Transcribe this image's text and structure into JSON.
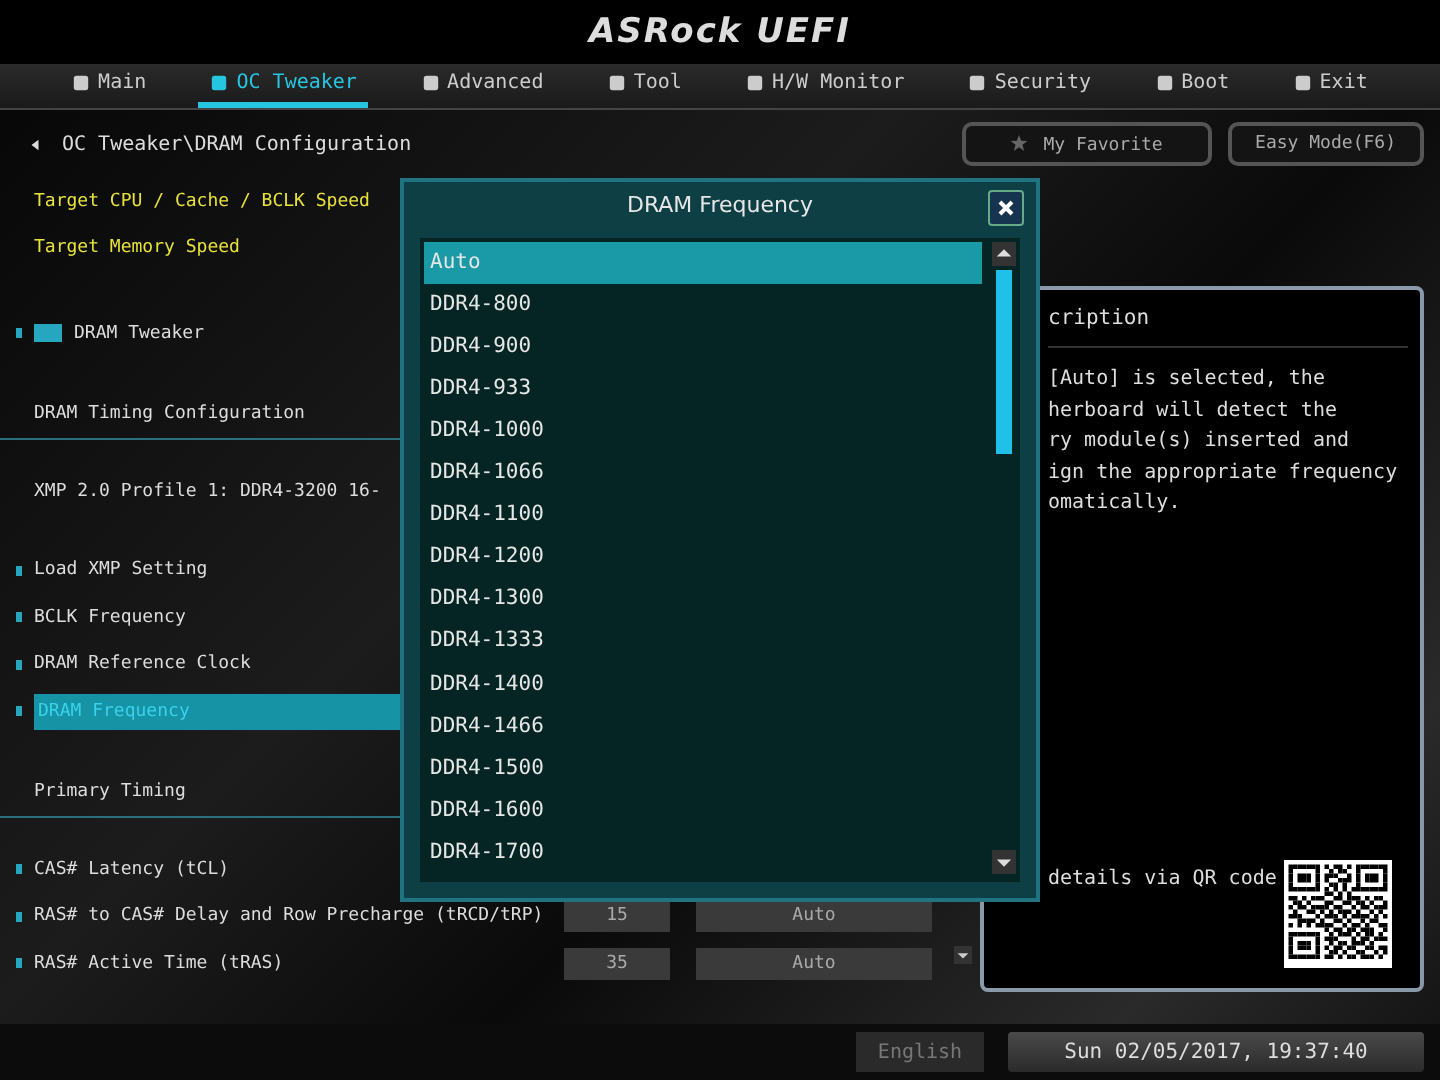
{
  "header": {
    "logo": "ASRock UEFI"
  },
  "tabs": [
    {
      "label": "Main",
      "selected": false
    },
    {
      "label": "OC Tweaker",
      "selected": true
    },
    {
      "label": "Advanced",
      "selected": false
    },
    {
      "label": "Tool",
      "selected": false
    },
    {
      "label": "H/W Monitor",
      "selected": false
    },
    {
      "label": "Security",
      "selected": false
    },
    {
      "label": "Boot",
      "selected": false
    },
    {
      "label": "Exit",
      "selected": false
    }
  ],
  "breadcrumb": "OC Tweaker\\DRAM Configuration",
  "favorite_button": "My Favorite",
  "easy_mode_button": "Easy Mode(F6)",
  "items": [
    {
      "kind": "info",
      "label": "Target CPU / Cache / BCLK Speed"
    },
    {
      "kind": "info",
      "label": "Target Memory Speed"
    },
    {
      "kind": "submenu",
      "label": "DRAM Tweaker"
    },
    {
      "kind": "section",
      "label": "DRAM Timing Configuration"
    },
    {
      "kind": "text",
      "label": "XMP 2.0 Profile 1: DDR4-3200 16-"
    },
    {
      "kind": "setting",
      "label": "Load XMP Setting",
      "selected": false
    },
    {
      "kind": "setting",
      "label": "BCLK Frequency",
      "selected": false
    },
    {
      "kind": "setting",
      "label": "DRAM Reference Clock",
      "selected": false
    },
    {
      "kind": "setting",
      "label": "DRAM Frequency",
      "selected": true
    },
    {
      "kind": "section",
      "label": "Primary Timing"
    },
    {
      "kind": "setting",
      "label": "CAS# Latency (tCL)",
      "selected": false
    },
    {
      "kind": "setting",
      "label": "RAS# to CAS# Delay and Row Precharge (tRCD/tRP)",
      "selected": false,
      "current": "15",
      "option": "Auto"
    },
    {
      "kind": "setting",
      "label": "RAS# Active Time (tRAS)",
      "selected": false,
      "current": "35",
      "option": "Auto"
    }
  ],
  "description": {
    "title": "cription",
    "lines": [
      "[Auto] is selected, the",
      "herboard will detect the",
      "ry module(s) inserted and",
      "ign the appropriate frequency",
      "omatically."
    ],
    "qr_caption": "details via QR code"
  },
  "footer": {
    "language": "English",
    "datetime": "Sun 02/05/2017, 19:37:40"
  },
  "dialog": {
    "title": "DRAM Frequency",
    "options": [
      {
        "label": "Auto",
        "selected": true
      },
      {
        "label": "DDR4-800",
        "selected": false
      },
      {
        "label": "DDR4-900",
        "selected": false
      },
      {
        "label": "DDR4-933",
        "selected": false
      },
      {
        "label": "DDR4-1000",
        "selected": false
      },
      {
        "label": "DDR4-1066",
        "selected": false
      },
      {
        "label": "DDR4-1100",
        "selected": false
      },
      {
        "label": "DDR4-1200",
        "selected": false
      },
      {
        "label": "DDR4-1300",
        "selected": false
      },
      {
        "label": "DDR4-1333",
        "selected": false
      },
      {
        "label": "DDR4-1400",
        "selected": false
      },
      {
        "label": "DDR4-1466",
        "selected": false
      },
      {
        "label": "DDR4-1500",
        "selected": false
      },
      {
        "label": "DDR4-1600",
        "selected": false
      },
      {
        "label": "DDR4-1700",
        "selected": false
      }
    ]
  }
}
